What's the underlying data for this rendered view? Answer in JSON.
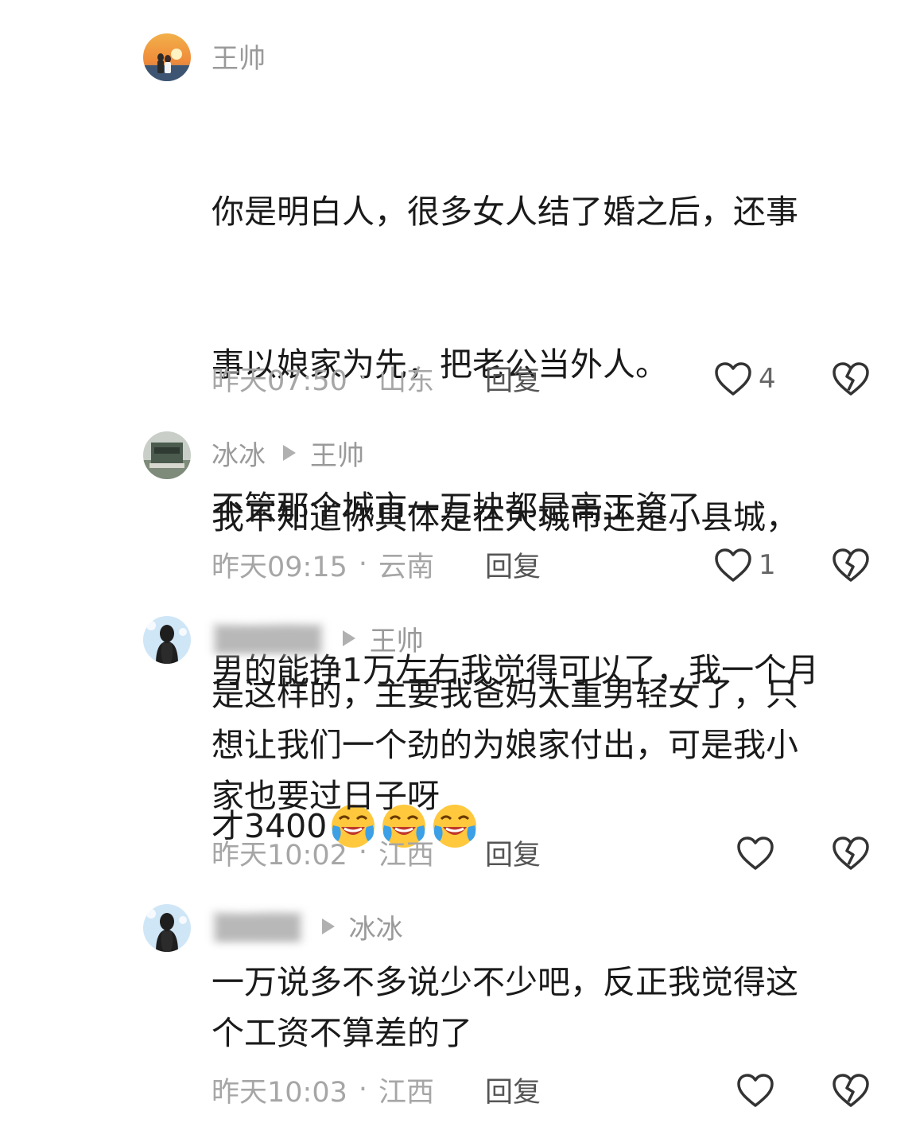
{
  "comments": [
    {
      "author": "王帅",
      "lines": [
        "你是明白人，很多女人结了婚之后，还事",
        "事以娘家为先，把老公当外人。",
        "我不知道你具体是在大城市还是小县城，",
        "男的能挣1万左右我觉得可以了，我一个月"
      ],
      "last_line": "才3400",
      "emoji_count": 3,
      "emoji_name": "crying-laughing-emoji",
      "time": "昨天07:50",
      "location": "山东",
      "reply_label": "回复",
      "likes": "4"
    },
    {
      "author": "冰冰",
      "reply_to": "王帅",
      "text": "不管那个城市一万块都是高工资了",
      "time": "昨天09:15",
      "location": "云南",
      "reply_label": "回复",
      "likes": "1"
    },
    {
      "author": "",
      "reply_to": "王帅",
      "text": "是这样的，主要我爸妈太重男轻女了，只\n想让我们一个劲的为娘家付出，可是我小\n家也要过日子呀",
      "time": "昨天10:02",
      "location": "江西",
      "reply_label": "回复",
      "likes": ""
    },
    {
      "author": "",
      "reply_to": "冰冰",
      "text": "一万说多不多说少不少吧，反正我觉得这\n个工资不算差的了",
      "time": "昨天10:03",
      "location": "江西",
      "reply_label": "回复",
      "likes": ""
    }
  ],
  "dot_separator": "·",
  "colors": {
    "text_primary": "#1a1a1a",
    "text_secondary": "#a6a6a6",
    "icon": "#333333"
  },
  "icons": {
    "like": "heart-outline-icon",
    "dislike": "broken-heart-icon",
    "reply_arrow": "triangle-right-icon"
  }
}
